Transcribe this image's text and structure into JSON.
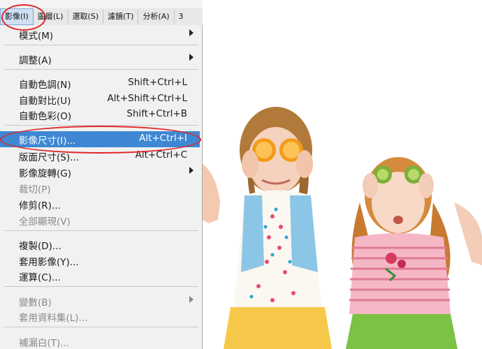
{
  "menubar": {
    "items": [
      {
        "label": "影像(I)"
      },
      {
        "label": "圖層(L)"
      },
      {
        "label": "選取(S)"
      },
      {
        "label": "濾鏡(T)"
      },
      {
        "label": "分析(A)"
      },
      {
        "label": "3"
      }
    ]
  },
  "menu": {
    "items": [
      {
        "label": "模式(M)",
        "shortcut": "",
        "submenu": true,
        "disabled": false
      },
      {
        "label": "調整(A)",
        "shortcut": "",
        "submenu": true,
        "disabled": false
      },
      {
        "label": "自動色調(N)",
        "shortcut": "Shift+Ctrl+L",
        "submenu": false,
        "disabled": false
      },
      {
        "label": "自動對比(U)",
        "shortcut": "Alt+Shift+Ctrl+L",
        "submenu": false,
        "disabled": false
      },
      {
        "label": "自動色彩(O)",
        "shortcut": "Shift+Ctrl+B",
        "submenu": false,
        "disabled": false
      },
      {
        "label": "影像尺寸(I)...",
        "shortcut": "Alt+Ctrl+I",
        "submenu": false,
        "disabled": false,
        "highlighted": true
      },
      {
        "label": "版面尺寸(S)...",
        "shortcut": "Alt+Ctrl+C",
        "submenu": false,
        "disabled": false
      },
      {
        "label": "影像旋轉(G)",
        "shortcut": "",
        "submenu": true,
        "disabled": false
      },
      {
        "label": "裁切(P)",
        "shortcut": "",
        "submenu": false,
        "disabled": true
      },
      {
        "label": "修剪(R)...",
        "shortcut": "",
        "submenu": false,
        "disabled": false
      },
      {
        "label": "全部顯現(V)",
        "shortcut": "",
        "submenu": false,
        "disabled": true
      },
      {
        "label": "複製(D)...",
        "shortcut": "",
        "submenu": false,
        "disabled": false
      },
      {
        "label": "套用影像(Y)...",
        "shortcut": "",
        "submenu": false,
        "disabled": false
      },
      {
        "label": "運算(C)...",
        "shortcut": "",
        "submenu": false,
        "disabled": false
      },
      {
        "label": "變數(B)",
        "shortcut": "",
        "submenu": true,
        "disabled": true
      },
      {
        "label": "套用資料集(L)...",
        "shortcut": "",
        "submenu": false,
        "disabled": true
      },
      {
        "label": "補漏白(T)...",
        "shortcut": "",
        "submenu": false,
        "disabled": true
      }
    ]
  },
  "colors": {
    "highlight": "#3f87d2",
    "annotation": "#e0262a"
  }
}
